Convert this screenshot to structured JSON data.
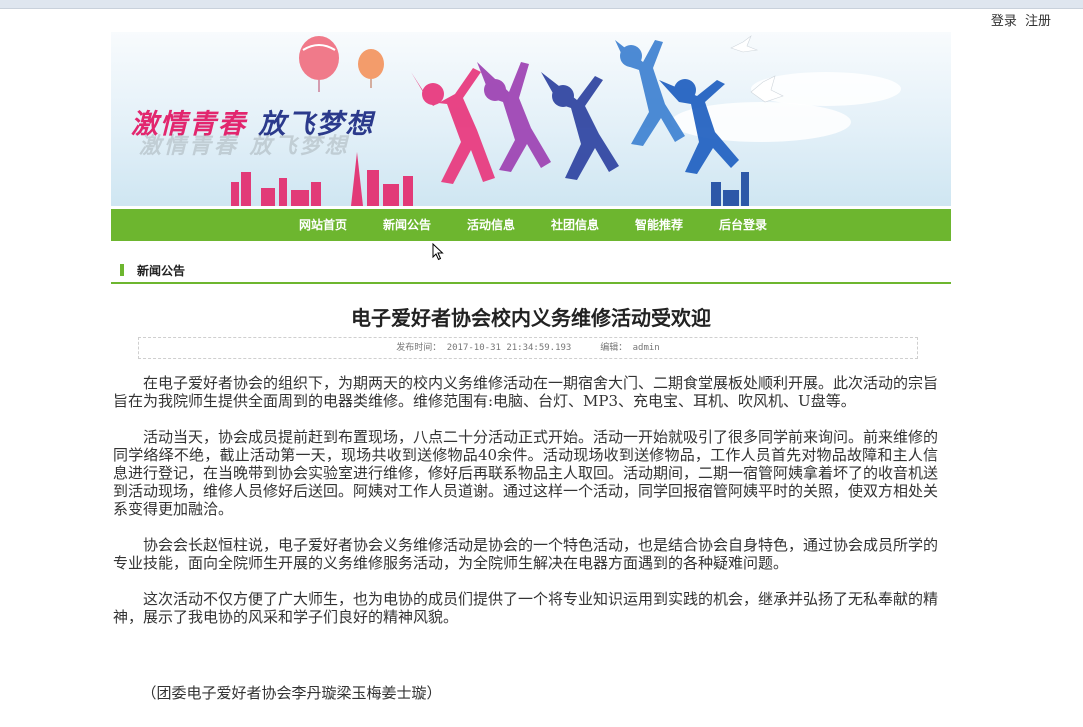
{
  "header": {
    "login": "登录",
    "register": "注册"
  },
  "banner": {
    "slogan_red": "激情青春",
    "slogan_blue": "放飞梦想",
    "slogan_shadow": "激情青春 放飞梦想"
  },
  "nav": {
    "items": [
      "网站首页",
      "新闻公告",
      "活动信息",
      "社团信息",
      "智能推荐",
      "后台登录"
    ]
  },
  "section": {
    "title": "新闻公告"
  },
  "article": {
    "title": "电子爱好者协会校内义务维修活动受欢迎",
    "publish_label": "发布时间：",
    "publish_time": "2017-10-31 21:34:59.193",
    "editor_label": "编辑：",
    "editor": "admin",
    "paragraphs": [
      "在电子爱好者协会的组织下，为期两天的校内义务维修活动在一期宿舍大门、二期食堂展板处顺利开展。此次活动的宗旨旨在为我院师生提供全面周到的电器类维修。维修范围有:电脑、台灯、MP3、充电宝、耳机、吹风机、U盘等。",
      "活动当天，协会成员提前赶到布置现场，八点二十分活动正式开始。活动一开始就吸引了很多同学前来询问。前来维修的同学络绎不绝，截止活动第一天，现场共收到送修物品40余件。活动现场收到送修物品，工作人员首先对物品故障和主人信息进行登记，在当晚带到协会实验室进行维修，修好后再联系物品主人取回。活动期间，二期一宿管阿姨拿着坏了的收音机送到活动现场，维修人员修好后送回。阿姨对工作人员道谢。通过这样一个活动，同学回报宿管阿姨平时的关照，使双方相处关系变得更加融洽。",
      "协会会长赵恒柱说，电子爱好者协会义务维修活动是协会的一个特色活动，也是结合协会自身特色，通过协会成员所学的专业技能，面向全院师生开展的义务维修服务活动，为全院师生解决在电器方面遇到的各种疑难问题。",
      "这次活动不仅方便了广大师生，也为电协的成员们提供了一个将专业知识运用到实践的机会，继承并弘扬了无私奉献的精神，展示了我电协的风采和学子们良好的精神风貌。"
    ],
    "signature": "（团委电子爱好者协会李丹璇梁玉梅姜士璇）"
  },
  "colors": {
    "nav_green": "#6db62f",
    "accent_pink": "#e2266e",
    "accent_blue": "#2b3a8c"
  }
}
